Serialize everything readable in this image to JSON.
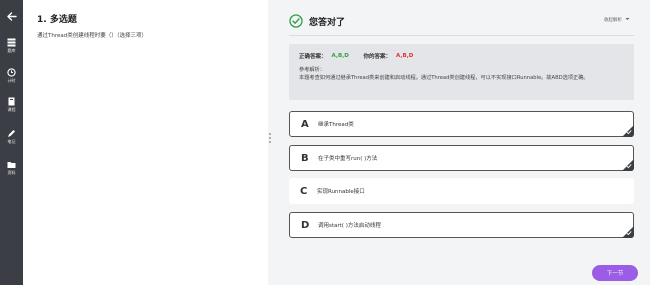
{
  "sidebar": {
    "items": [
      {
        "label": "题库",
        "icon": "book-icon"
      },
      {
        "label": "计时",
        "icon": "clock-icon"
      },
      {
        "label": "课程",
        "icon": "course-icon"
      },
      {
        "label": "笔记",
        "icon": "pen-icon"
      },
      {
        "label": "资料",
        "icon": "folder-icon"
      }
    ]
  },
  "question": {
    "title": "1. 多选题",
    "text": "通过Thread类创建线程时要（）（选择三项）"
  },
  "result": {
    "status": "您答对了",
    "toggle_label": "收起解析"
  },
  "analysis": {
    "correct_label": "正确答案：",
    "correct_value": "A,B,D",
    "mine_label": "你的答案：",
    "mine_value": "A,B,D",
    "ref_label": "参考解析：",
    "ref_text": "本题考查如何通过继承Thread类来创建和启动线程。通过Thread类创建线程，可以不实现接口Runnable。故ABD选项正确。"
  },
  "options": [
    {
      "letter": "A",
      "text": "继承Thread类",
      "selected": true
    },
    {
      "letter": "B",
      "text": "在子类中重写run( )方法",
      "selected": true
    },
    {
      "letter": "C",
      "text": "实现Runnable接口",
      "selected": false
    },
    {
      "letter": "D",
      "text": "调用start( )方法启动线程",
      "selected": true
    }
  ],
  "next_label": "下一节",
  "colors": {
    "sidebar": "#3b3f45",
    "correct": "#2f9e44",
    "mine": "#e03131",
    "accent": "#9b5de5"
  }
}
